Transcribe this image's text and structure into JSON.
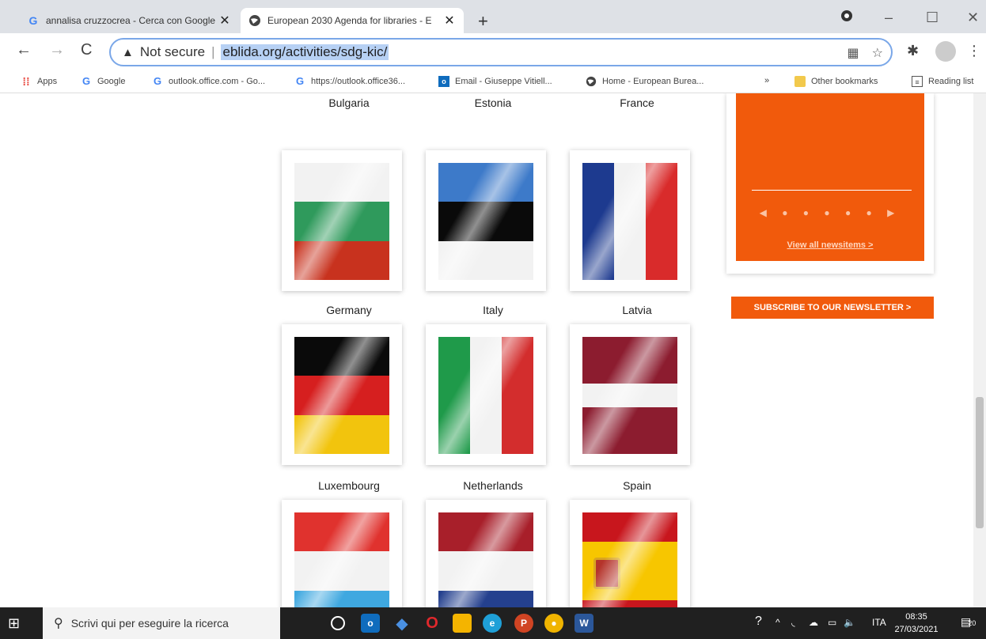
{
  "browser": {
    "tabs": [
      {
        "title": "annalisa cruzzocrea - Cerca con Google",
        "icon": "google-icon",
        "active": false
      },
      {
        "title": "European 2030 Agenda for libraries - E",
        "icon": "globe-icon",
        "active": true
      }
    ],
    "new_tab": "+",
    "address": {
      "security": "Not secure",
      "url": "eblida.org/activities/sdg-kic/"
    },
    "bookmarks": [
      {
        "label": "Apps",
        "icon": "apps-grid-icon"
      },
      {
        "label": "Google",
        "icon": "google-icon"
      },
      {
        "label": "outlook.office.com - Go...",
        "icon": "google-icon"
      },
      {
        "label": "https://outlook.office36...",
        "icon": "google-icon"
      },
      {
        "label": "Email - Giuseppe Vitiell...",
        "icon": "outlook-icon"
      },
      {
        "label": "Home - European Burea...",
        "icon": "globe-icon"
      }
    ],
    "bookmarks_overflow": "»",
    "other_bookmarks": "Other bookmarks",
    "reading_list": "Reading list"
  },
  "page": {
    "flags": [
      {
        "country": "Bulgaria"
      },
      {
        "country": "Estonia"
      },
      {
        "country": "France"
      },
      {
        "country": "Germany"
      },
      {
        "country": "Italy"
      },
      {
        "country": "Latvia"
      },
      {
        "country": "Luxembourg"
      },
      {
        "country": "Netherlands"
      },
      {
        "country": "Spain"
      }
    ],
    "news": {
      "link": "View all newsitems >"
    },
    "subscribe": "SUBSCRIBE TO OUR NEWSLETTER >"
  },
  "taskbar": {
    "search_placeholder": "Scrivi qui per eseguire la ricerca",
    "lang": "ITA",
    "time": "08:35",
    "date": "27/03/2021",
    "notifications": "20"
  },
  "colors": {
    "accent_orange": "#f15a0c",
    "omnibox_border": "#7aa7e8"
  }
}
